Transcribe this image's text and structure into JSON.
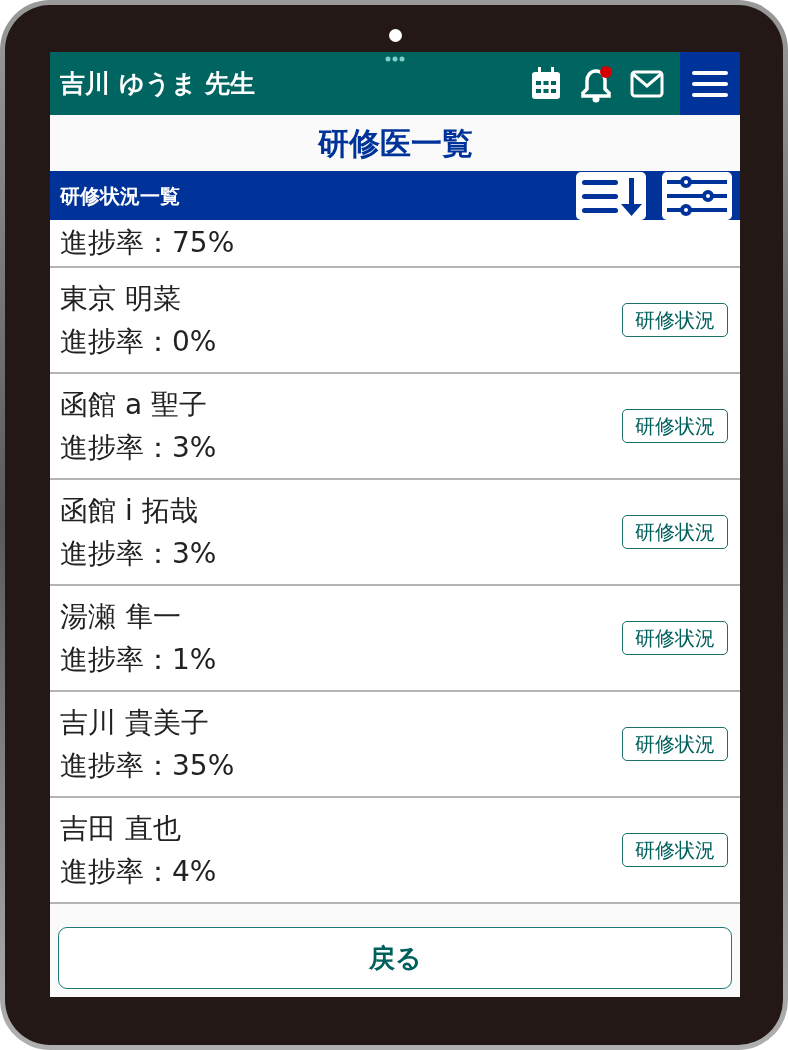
{
  "header": {
    "user": "吉川 ゆうま 先生",
    "notification_dot": true
  },
  "page_title": "研修医一覧",
  "section": {
    "title": "研修状況一覧"
  },
  "rows": [
    {
      "progress": "進捗率：75%"
    },
    {
      "name": "東京 明菜",
      "progress": "進捗率：0%",
      "button": "研修状況"
    },
    {
      "name": "函館 a 聖子",
      "progress": "進捗率：3%",
      "button": "研修状況"
    },
    {
      "name": "函館 i 拓哉",
      "progress": "進捗率：3%",
      "button": "研修状況"
    },
    {
      "name": "湯瀬 隼一",
      "progress": "進捗率：1%",
      "button": "研修状況"
    },
    {
      "name": "吉川 貴美子",
      "progress": "進捗率：35%",
      "button": "研修状況"
    },
    {
      "name": "吉田 直也",
      "progress": "進捗率：4%",
      "button": "研修状況"
    }
  ],
  "back_button": "戻る"
}
